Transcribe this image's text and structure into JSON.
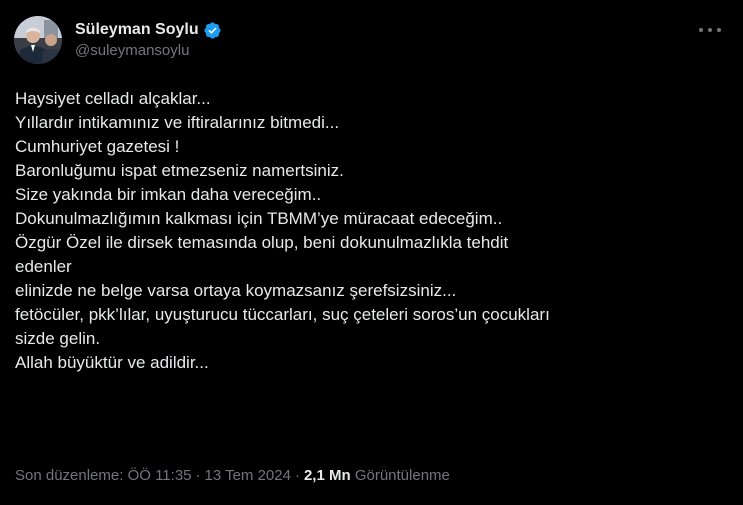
{
  "author": {
    "display_name": "Süleyman Soylu",
    "handle": "@suleymansoylu",
    "verified_color": "#1d9bf0"
  },
  "menu": {
    "icon": "more-horizontal-icon"
  },
  "tweet": {
    "lines": [
      "Haysiyet celladı alçaklar...",
      "Yıllardır intikamınız ve iftiralarınız bitmedi...",
      "Cumhuriyet gazetesi !",
      "Baronluğumu ispat etmezseniz namertsiniz.",
      "Size yakında bir imkan daha vereceğim..",
      "Dokunulmazlığımın kalkması için TBMM’ye müracaat edeceğim..",
      "Özgür Özel ile dirsek temasında olup, beni dokunulmazlıkla tehdit",
      "edenler",
      "elinizde ne belge varsa ortaya koymazsanız şerefsizsiniz...",
      "fetöcüler, pkk’lılar, uyuşturucu tüccarları, suç çeteleri soros’un çocukları",
      "sizde gelin.",
      "Allah büyüktür ve adildir..."
    ]
  },
  "footer": {
    "edited": "Son düzenleme: ÖÖ 11:35",
    "separator": "·",
    "date": "13 Tem 2024",
    "views_count": "2,1 Mn",
    "views_label": "Görüntülenme"
  },
  "colors": {
    "background": "#000000",
    "text": "#e7e9ea",
    "muted": "#71767b"
  }
}
